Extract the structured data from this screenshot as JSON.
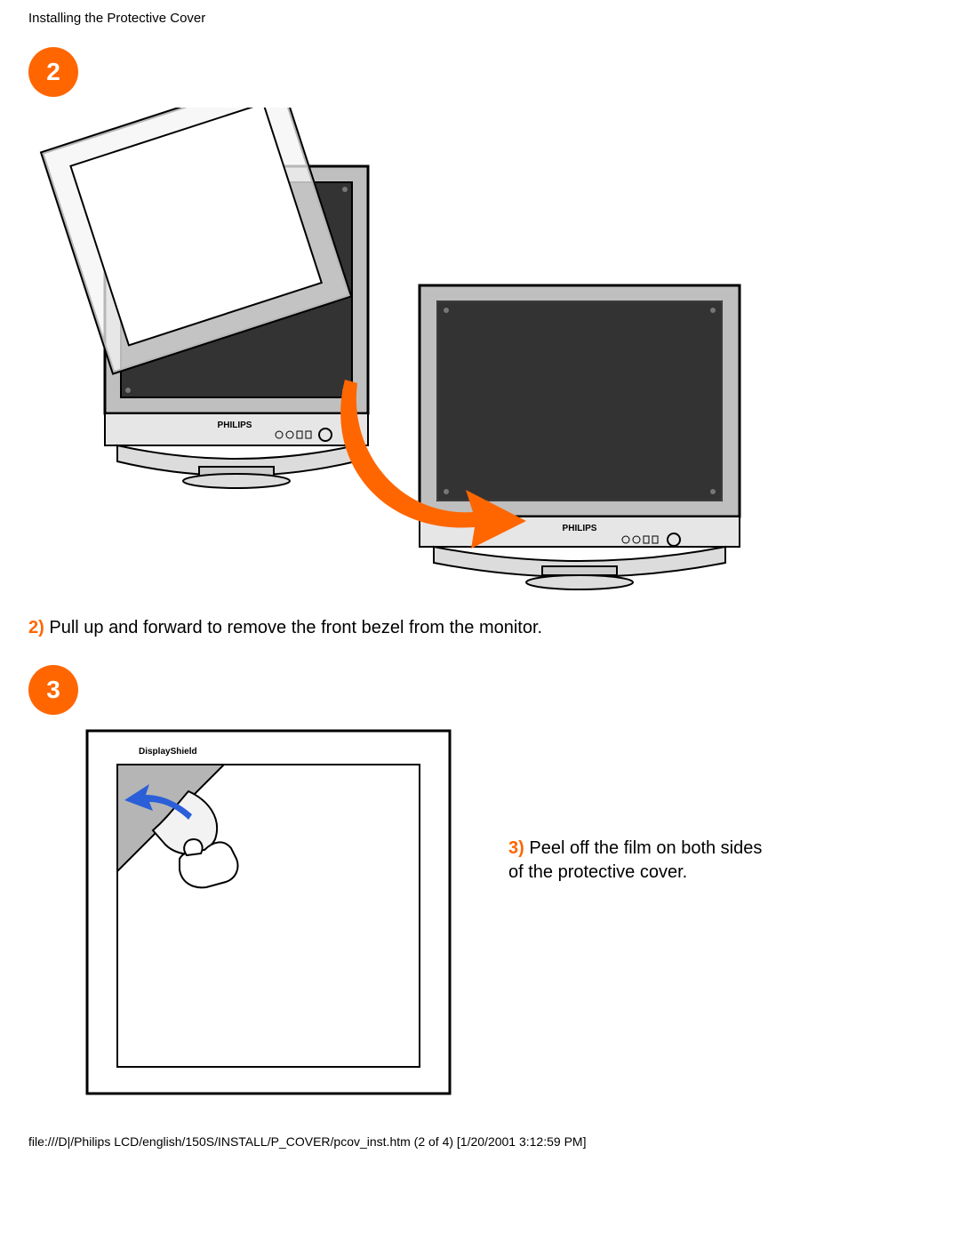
{
  "header": {
    "title": "Installing the Protective Cover"
  },
  "steps": {
    "s2": {
      "badge": "2",
      "num": "2)",
      "text": " Pull up and forward to remove the front bezel from the monitor."
    },
    "s3": {
      "badge": "3",
      "num": "3)",
      "text": " Peel off the film on both sides of the protective cover."
    }
  },
  "footer": {
    "line": "file:///D|/Philips LCD/english/150S/INSTALL/P_COVER/pcov_inst.htm (2 of 4) [1/20/2001 3:12:59 PM]"
  }
}
